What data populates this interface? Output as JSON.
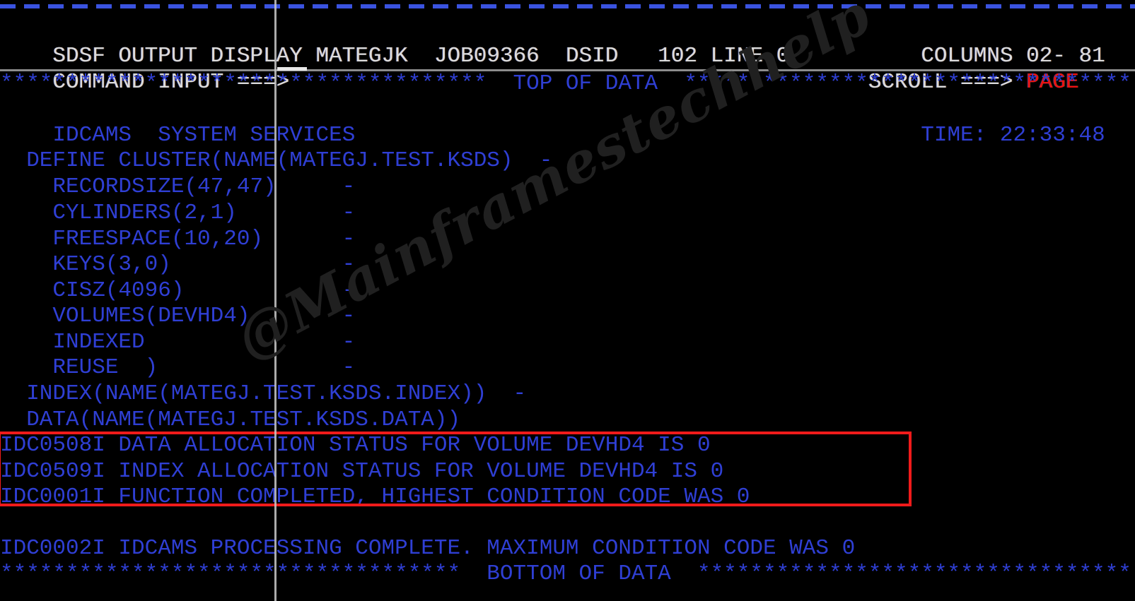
{
  "colors": {
    "background": "#000000",
    "body_text": "#2f3fd4",
    "header_text": "#dcdcdc",
    "accent_red": "#ee1111",
    "annotation_box": "#f01b1b",
    "rule_gray": "#8c8c8c",
    "watermark": "#202020"
  },
  "header": {
    "panel_title": "SDSF OUTPUT DISPLAY",
    "jobname": "MATEGJK",
    "jobid": "JOB09366",
    "dsid_label": "DSID",
    "dsid_value": "102",
    "line_label": "LINE",
    "line_value": "0",
    "columns_label": "COLUMNS",
    "columns_value": "02- 81",
    "line1_full": " SDSF OUTPUT DISPLAY MATEGJK  JOB09366  DSID   102 LINE 0          COLUMNS 02- 81",
    "command_label": "COMMAND INPUT ===>",
    "command_value": "",
    "scroll_label": "SCROLL ===>",
    "scroll_value": "PAGE"
  },
  "markers": {
    "top_of_data": "*************************************  TOP OF DATA  **********************************",
    "bottom_of_data": "***********************************  BOTTOM OF DATA  *********************************"
  },
  "output": {
    "idcams_banner": "IDCAMS  SYSTEM SERVICES",
    "time_label": "TIME:",
    "time_value": "22:33:48",
    "jcl_lines": [
      "  DEFINE CLUSTER(NAME(MATEGJ.TEST.KSDS)  -",
      "    RECORDSIZE(47,47)     -",
      "    CYLINDERS(2,1)        -",
      "    FREESPACE(10,20)      -",
      "    KEYS(3,0)             -",
      "    CISZ(4096)            -",
      "    VOLUMES(DEVHD4)       -",
      "    INDEXED               -",
      "    REUSE  )              -",
      "  INDEX(NAME(MATEGJ.TEST.KSDS.INDEX))  -",
      "  DATA(NAME(MATEGJ.TEST.KSDS.DATA))"
    ],
    "highlighted_messages": [
      "IDC0508I DATA ALLOCATION STATUS FOR VOLUME DEVHD4 IS 0",
      "IDC0509I INDEX ALLOCATION STATUS FOR VOLUME DEVHD4 IS 0",
      "IDC0001I FUNCTION COMPLETED, HIGHEST CONDITION CODE WAS 0"
    ],
    "final_message": "IDC0002I IDCAMS PROCESSING COMPLETE. MAXIMUM CONDITION CODE WAS 0"
  },
  "watermark": {
    "text": "@Mainframestechhelp"
  }
}
